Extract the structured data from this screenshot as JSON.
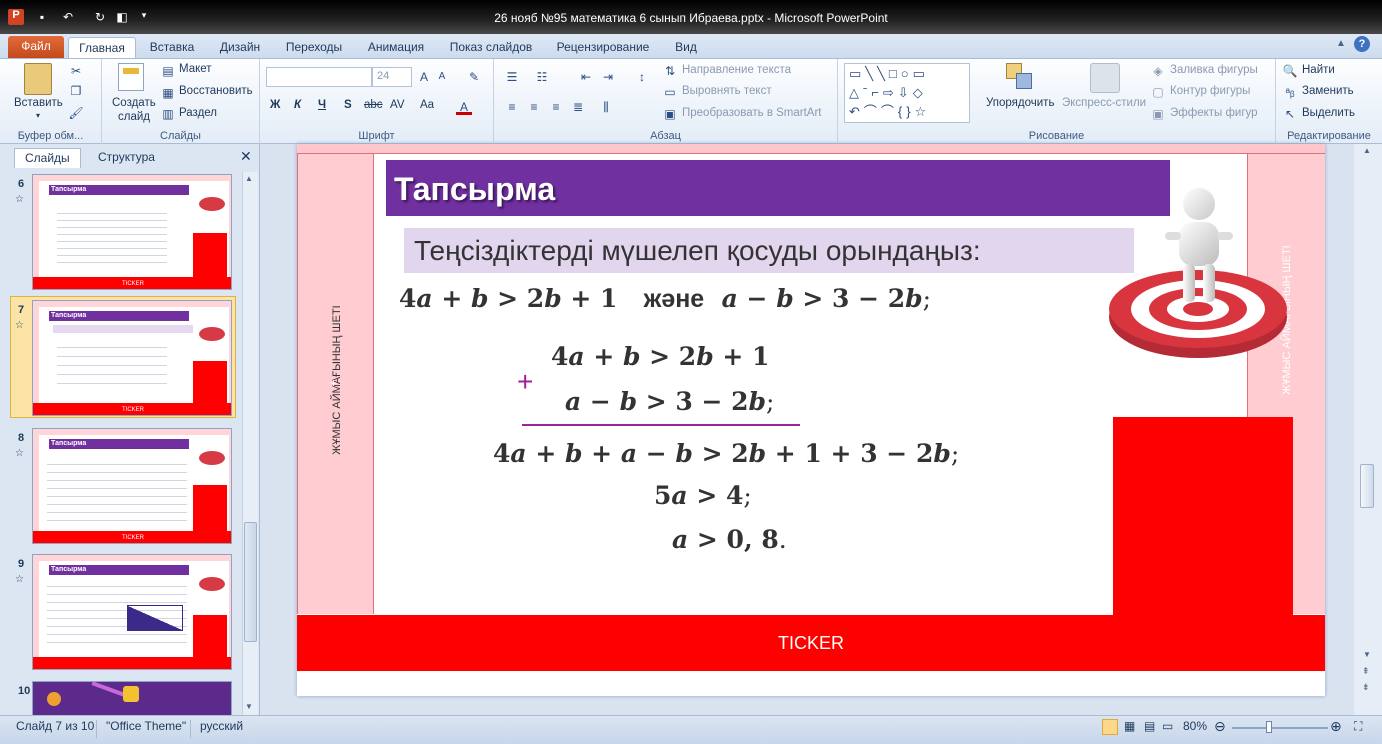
{
  "window": {
    "title": "26 нояб №95 математика 6 сынып Ибраева.pptx  -  Microsoft PowerPoint",
    "app_icon": "powerpoint-icon"
  },
  "ribbon_tabs": [
    {
      "label": "Файл"
    },
    {
      "label": "Главная"
    },
    {
      "label": "Вставка"
    },
    {
      "label": "Дизайн"
    },
    {
      "label": "Переходы"
    },
    {
      "label": "Анимация"
    },
    {
      "label": "Показ слайдов"
    },
    {
      "label": "Рецензирование"
    },
    {
      "label": "Вид"
    }
  ],
  "ribbon": {
    "clipboard": {
      "paste": "Вставить",
      "group": "Буфер обм..."
    },
    "slides": {
      "create": "Создать",
      "create2": "слайд",
      "layout": "Макет",
      "reset": "Восстановить",
      "section": "Раздел",
      "group": "Слайды"
    },
    "font": {
      "size": "24",
      "group": "Шрифт",
      "bold": "Ж",
      "italic": "К",
      "underline": "Ч",
      "shadow": "S",
      "strike": "abc",
      "spacing": "AV",
      "case": "Aa"
    },
    "paragraph": {
      "text_direction": "Направление текста",
      "align_text": "Выровнять текст",
      "smartart": "Преобразовать в SmartArt",
      "group": "Абзац"
    },
    "drawing": {
      "arrange": "Упорядочить",
      "quick_styles": "Экспресс-стили",
      "fill": "Заливка фигуры",
      "outline": "Контур фигуры",
      "effects": "Эффекты фигур",
      "group": "Рисование"
    },
    "editing": {
      "find": "Найти",
      "replace": "Заменить",
      "select": "Выделить",
      "group": "Редактирование"
    }
  },
  "panel": {
    "tab_slides": "Слайды",
    "tab_outline": "Структура",
    "thumbs": [
      {
        "num": "6",
        "title": "Тапсырма",
        "footer": "TICKER"
      },
      {
        "num": "7",
        "title": "Тапсырма",
        "footer": "TICKER"
      },
      {
        "num": "8",
        "title": "Тапсырма",
        "footer": "TICKER"
      },
      {
        "num": "9",
        "title": "Тапсырма",
        "footer": "TICKER"
      },
      {
        "num": "10"
      }
    ]
  },
  "slide": {
    "title": "Тапсырма",
    "subtitle": "Теңсіздіктерді мүшелеп қосуды орындаңыз:",
    "side_left": "ЖҰМЫС АЙМАҒЫНЫҢ ШЕТІ",
    "side_right": "ЖҰМЫС АЙМАҒЫНЫҢ ШЕТІ",
    "ticker": "TICKER",
    "and_word": "және",
    "plus": "+",
    "small_plus": "+"
  },
  "status": {
    "slide_info": "Слайд 7 из 10",
    "theme": "\"Office Theme\"",
    "language": "русский",
    "zoom": "80%"
  }
}
